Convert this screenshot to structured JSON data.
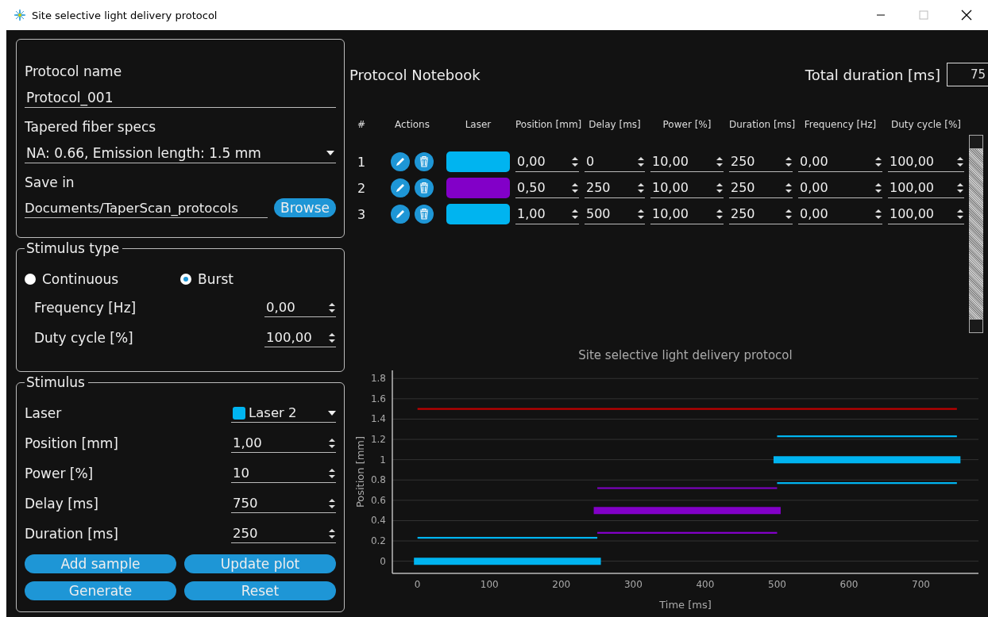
{
  "window": {
    "title": "Site selective light delivery protocol"
  },
  "protocol": {
    "name_label": "Protocol name",
    "name_value": "Protocol_001",
    "fiber_label": "Tapered fiber specs",
    "fiber_value": "NA: 0.66, Emission length: 1.5 mm",
    "save_label": "Save in",
    "save_value": "Documents/TaperScan_protocols",
    "browse": "Browse"
  },
  "stimulus_type": {
    "title": "Stimulus type",
    "options": [
      {
        "label": "Continuous",
        "selected": false
      },
      {
        "label": "Burst",
        "selected": true
      }
    ],
    "fields": [
      {
        "label": "Frequency [Hz]",
        "value": "0,00"
      },
      {
        "label": "Duty cycle [%]",
        "value": "100,00"
      }
    ]
  },
  "stimulus": {
    "title": "Stimulus",
    "fields": [
      {
        "kind": "laser",
        "label": "Laser",
        "value": "Laser 2",
        "color": "#00b4f0"
      },
      {
        "kind": "spin",
        "label": "Position [mm]",
        "value": "1,00"
      },
      {
        "kind": "spin",
        "label": "Power [%]",
        "value": "10"
      },
      {
        "kind": "spin",
        "label": "Delay [ms]",
        "value": "750"
      },
      {
        "kind": "spin",
        "label": "Duration [ms]",
        "value": "250"
      }
    ],
    "buttons": [
      "Add sample",
      "Update plot",
      "Generate",
      "Reset"
    ]
  },
  "notebook": {
    "title": "Protocol Notebook",
    "total_label": "Total duration [ms]",
    "total_value": "75",
    "columns": [
      "#",
      "Actions",
      "Laser",
      "Position [mm]",
      "Delay [ms]",
      "Power [%]",
      "Duration [ms]",
      "Frequency [Hz]",
      "Duty cycle [%]"
    ],
    "rows": [
      {
        "index": "1",
        "color": "#00b4f0",
        "values": [
          "0,00",
          "0",
          "10,00",
          "250",
          "0,00",
          "100,00"
        ]
      },
      {
        "index": "2",
        "color": "#8200c8",
        "values": [
          "0,50",
          "250",
          "10,00",
          "250",
          "0,00",
          "100,00"
        ]
      },
      {
        "index": "3",
        "color": "#00b4f0",
        "values": [
          "1,00",
          "500",
          "10,00",
          "250",
          "0,00",
          "100,00"
        ]
      }
    ]
  },
  "chart": {
    "chart_data": {
      "type": "line",
      "grid": true,
      "title": "Site selective light delivery protocol",
      "xlabel": "Time [ms]",
      "ylabel": "Position [mm]",
      "x": [
        0,
        250,
        500,
        750
      ],
      "xlim": [
        -35,
        780
      ],
      "ylim": [
        -0.12,
        1.88
      ],
      "xticks": [
        0,
        100,
        200,
        300,
        400,
        500,
        600,
        700
      ],
      "yticks": [
        0,
        0.2,
        0.4,
        0.6,
        0.8,
        1,
        1.2,
        1.4,
        1.6,
        1.8
      ],
      "series": [
        {
          "color": "#c00000",
          "values": [
            1.5,
            1.5,
            1.5,
            1.5
          ]
        },
        {
          "color": "#00b4f0",
          "values": [
            0,
            0,
            null,
            null
          ]
        },
        {
          "color": "#00b4f0",
          "values": [
            0.23,
            0.23,
            null,
            null
          ]
        },
        {
          "color": "#8200c8",
          "values": [
            null,
            0.5,
            0.5,
            null
          ]
        },
        {
          "color": "#8200c8",
          "values": [
            null,
            0.72,
            0.72,
            null
          ]
        },
        {
          "color": "#8200c8",
          "values": [
            null,
            0.28,
            0.28,
            null
          ]
        },
        {
          "color": "#00b4f0",
          "values": [
            null,
            null,
            1,
            1
          ]
        },
        {
          "color": "#00b4f0",
          "values": [
            null,
            null,
            1.23,
            1.23
          ]
        },
        {
          "color": "#00b4f0",
          "values": [
            null,
            null,
            0.77,
            0.77
          ]
        }
      ]
    }
  }
}
